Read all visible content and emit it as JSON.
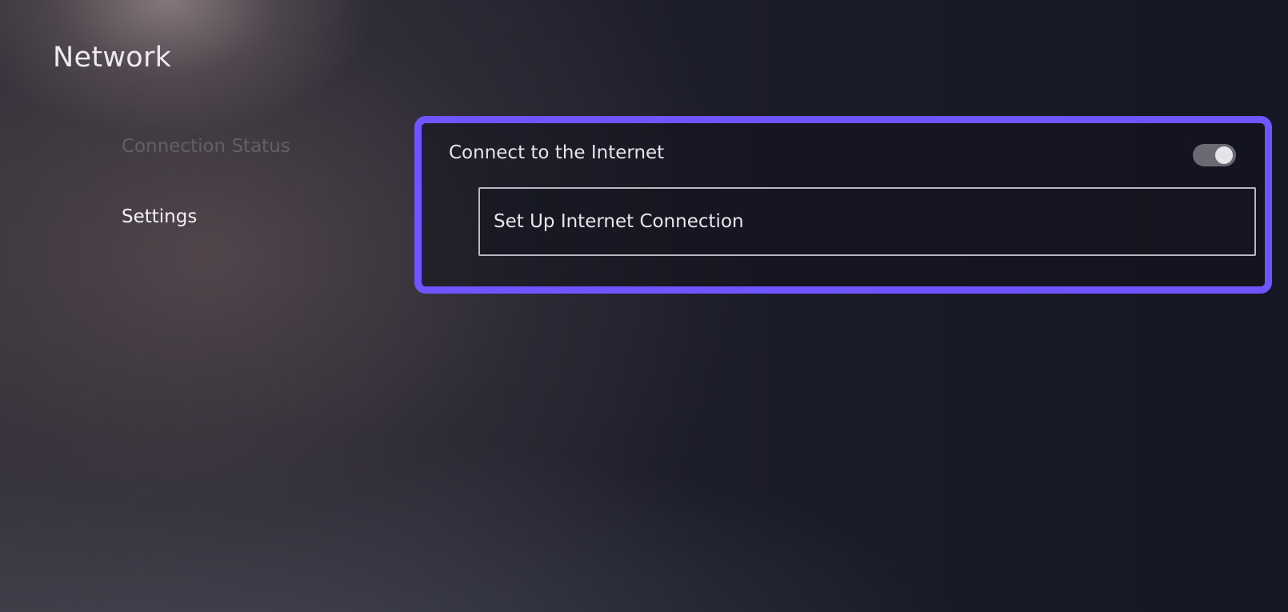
{
  "header": {
    "title": "Network"
  },
  "sidebar": {
    "items": [
      {
        "label": "Connection Status",
        "state": "dimmed"
      },
      {
        "label": "Settings",
        "state": "active"
      }
    ]
  },
  "panel": {
    "connect_toggle": {
      "label": "Connect to the Internet",
      "on": true
    },
    "setup_button": {
      "label": "Set Up Internet Connection"
    },
    "focus_color": "#6f55ff"
  }
}
